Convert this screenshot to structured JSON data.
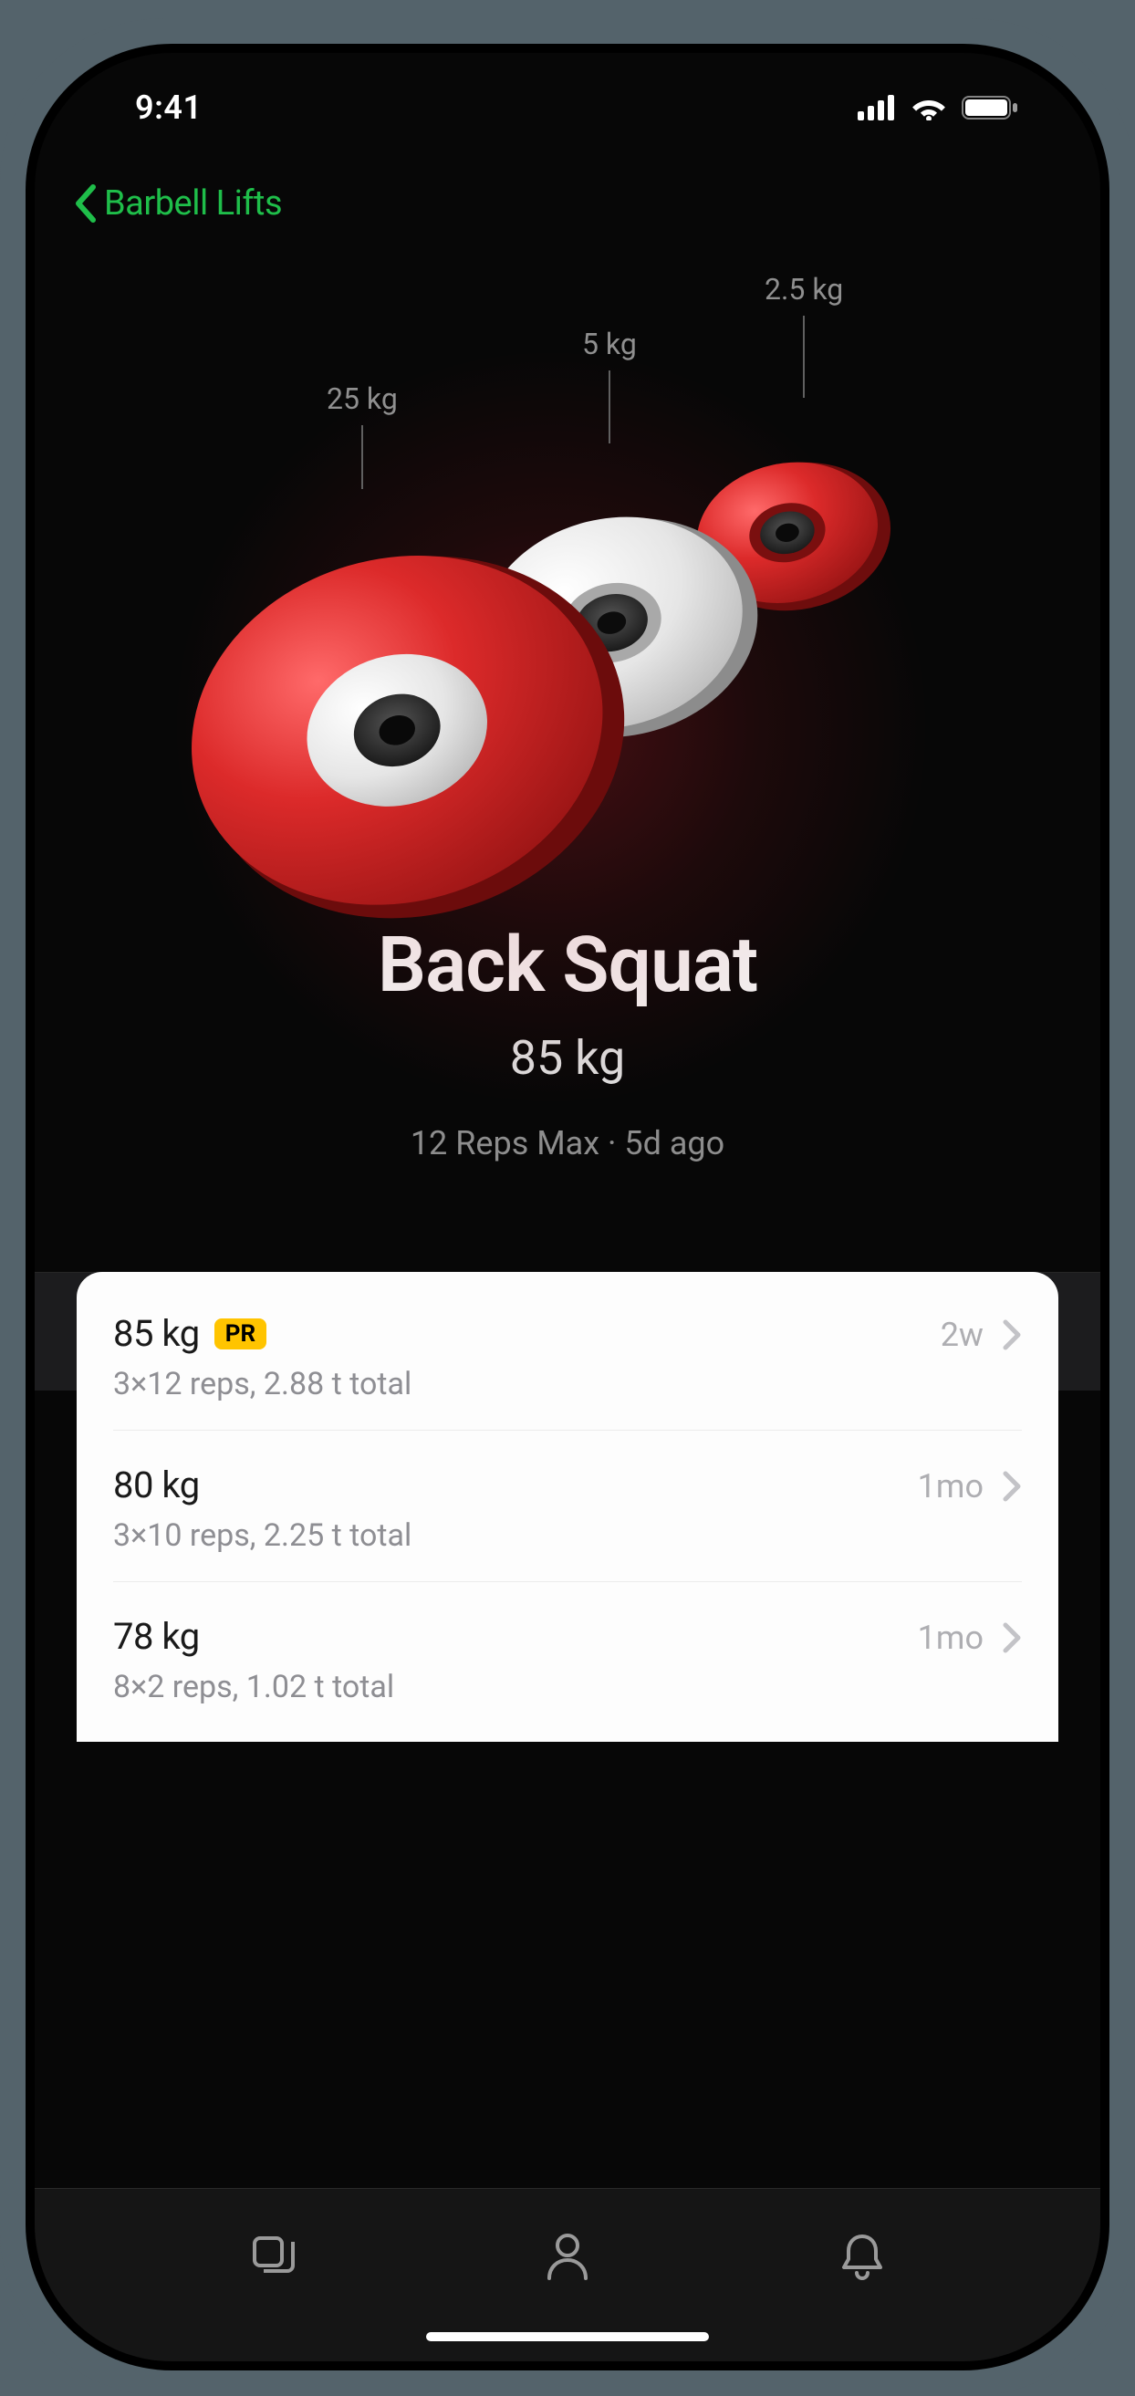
{
  "status": {
    "time": "9:41"
  },
  "nav": {
    "back_label": "Barbell Lifts"
  },
  "plates": {
    "p25": "25 kg",
    "p5": "5 kg",
    "p2_5": "2.5 kg"
  },
  "hero": {
    "title": "Back Squat",
    "weight": "85 kg",
    "subtitle": "12 Reps Max · 5d ago"
  },
  "pr_badge": "PR",
  "history": [
    {
      "weight": "85 kg",
      "pr": true,
      "sub": "3×12 reps, 2.88 t total",
      "when": "2w"
    },
    {
      "weight": "80 kg",
      "pr": false,
      "sub": "3×10 reps, 2.25 t total",
      "when": "1mo"
    },
    {
      "weight": "78 kg",
      "pr": false,
      "sub": "8×2 reps, 1.02 t total",
      "when": "1mo"
    }
  ]
}
